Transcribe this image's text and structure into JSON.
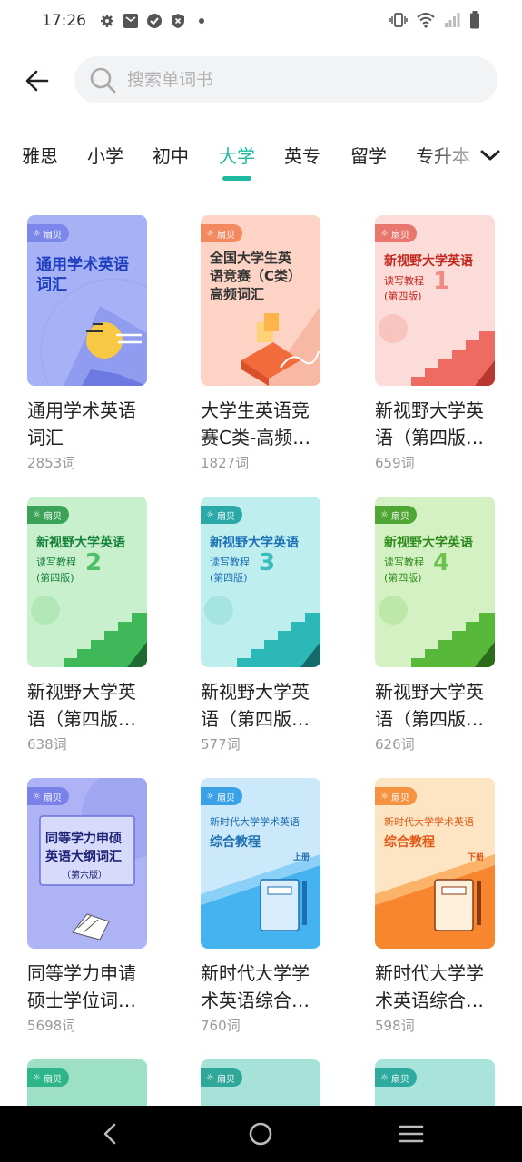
{
  "status_bar": {
    "time": "17:26"
  },
  "search": {
    "placeholder": "搜索单词书"
  },
  "tabs": [
    {
      "label": "雅思",
      "active": false
    },
    {
      "label": "小学",
      "active": false
    },
    {
      "label": "初中",
      "active": false
    },
    {
      "label": "大学",
      "active": true
    },
    {
      "label": "英专",
      "active": false
    },
    {
      "label": "留学",
      "active": false
    },
    {
      "label": "专升本",
      "active": false
    }
  ],
  "brand_badge": "扇贝",
  "books": [
    {
      "title": "通用学术英语词汇",
      "count": "2853词",
      "cover_line1": "通用学术英语",
      "cover_line2": "词汇"
    },
    {
      "title": "大学生英语竞赛C类-高频…",
      "count": "1827词",
      "cover_line1": "全国大学生英",
      "cover_line2": "语竞赛（C类）",
      "cover_line3": "高频词汇"
    },
    {
      "title": "新视野大学英语（第四版…",
      "count": "659词",
      "cover_line1": "新视野大学英语",
      "cover_sub1": "读写教程",
      "cover_sub2": "(第四版)",
      "cover_num": "1"
    },
    {
      "title": "新视野大学英语（第四版…",
      "count": "638词",
      "cover_line1": "新视野大学英语",
      "cover_sub1": "读写教程",
      "cover_sub2": "(第四版)",
      "cover_num": "2"
    },
    {
      "title": "新视野大学英语（第四版…",
      "count": "577词",
      "cover_line1": "新视野大学英语",
      "cover_sub1": "读写教程",
      "cover_sub2": "(第四版)",
      "cover_num": "3"
    },
    {
      "title": "新视野大学英语（第四版…",
      "count": "626词",
      "cover_line1": "新视野大学英语",
      "cover_sub1": "读写教程",
      "cover_sub2": "(第四版)",
      "cover_num": "4"
    },
    {
      "title": "同等学力申请硕士学位词…",
      "count": "5698词",
      "cover_line1": "同等学力申硕",
      "cover_line2": "英语大纲词汇",
      "cover_line3": "（第六版）"
    },
    {
      "title": "新时代大学学术英语综合…",
      "count": "760词",
      "cover_line1": "新时代大学学术英语",
      "cover_line2": "综合教程",
      "cover_line3": "上册"
    },
    {
      "title": "新时代大学学术英语综合…",
      "count": "598词",
      "cover_line1": "新时代大学学术英语",
      "cover_line2": "综合教程",
      "cover_line3": "下册"
    }
  ],
  "colors": {
    "accent": "#1fb9a0"
  }
}
